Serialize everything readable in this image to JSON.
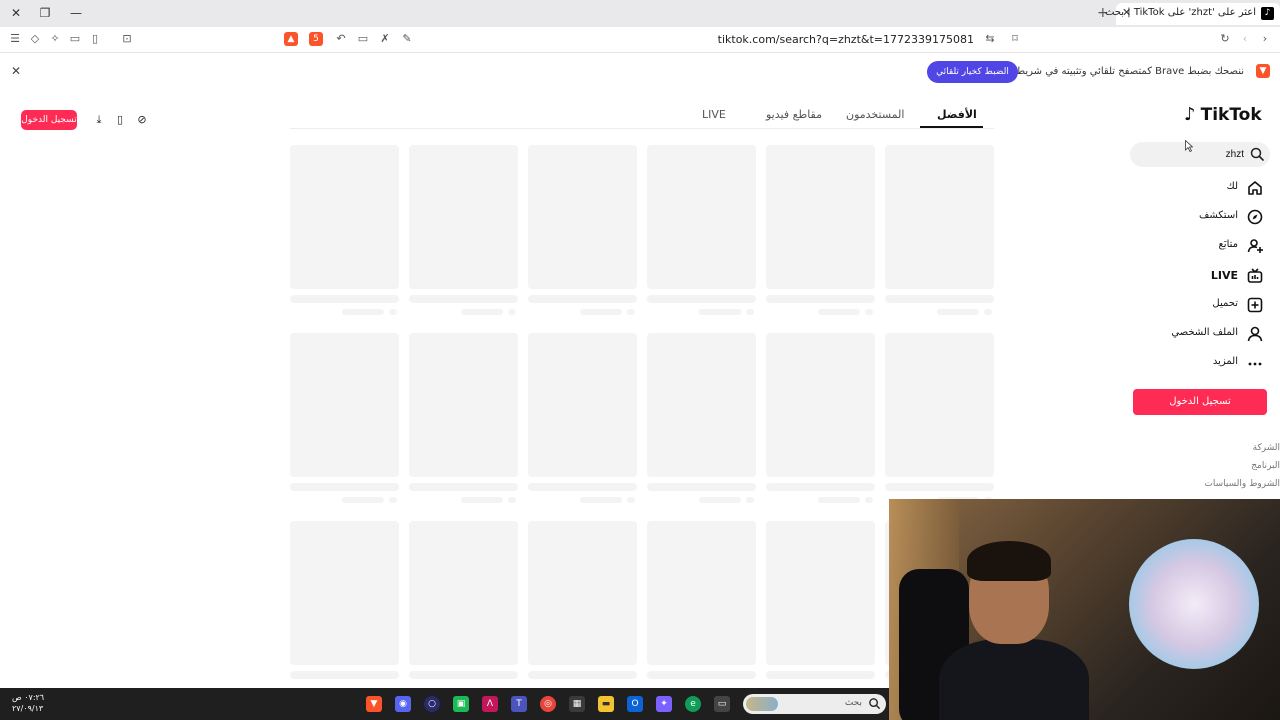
{
  "window": {
    "tab_title": "اعثر على 'zhzt' على TikTok | بحث",
    "tab_favicon": "tiktok-icon"
  },
  "toolbar": {
    "url": "tiktok.com/search?q=zhzt&t=1772339175081",
    "shield_count": "5"
  },
  "notification": {
    "text": "ننصحك بضبط Brave كمتصفح تلقائي وتثبيته في شريط المهام",
    "button_label": "الضبط كخيار تلقائي"
  },
  "header_actions": {
    "login_label": "تسجيل الدخول"
  },
  "search_tabs": {
    "top": "الأفضل",
    "users": "المستخدمون",
    "videos": "مقاطع فيديو",
    "live": "LIVE"
  },
  "sidebar": {
    "logo_text": "TikTok",
    "search_value": "zhzt",
    "items": [
      {
        "label": "لك",
        "icon": "home-icon"
      },
      {
        "label": "استكشف",
        "icon": "compass-icon"
      },
      {
        "label": "متابَع",
        "icon": "following-icon"
      },
      {
        "label": "LIVE",
        "icon": "live-icon"
      },
      {
        "label": "تحميل",
        "icon": "upload-icon"
      },
      {
        "label": "الملف الشخصي",
        "icon": "profile-icon"
      },
      {
        "label": "المزيد",
        "icon": "more-icon"
      }
    ],
    "login_label": "تسجيل الدخول",
    "footer": [
      "الشركة",
      "البرنامج",
      "الشروط والسياسات"
    ]
  },
  "taskbar": {
    "time": "٠٧:٢٦ ص",
    "date": "٢٧/٠٩/١٣",
    "search_placeholder": "بحث"
  }
}
